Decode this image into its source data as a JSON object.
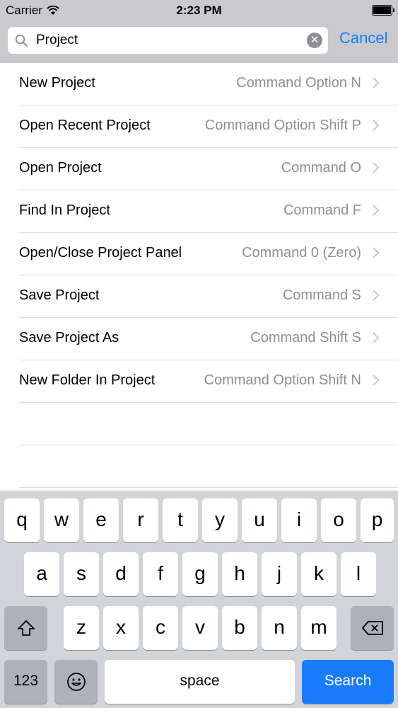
{
  "status_bar": {
    "carrier": "Carrier",
    "time": "2:23 PM"
  },
  "search": {
    "value": "Project",
    "cancel_label": "Cancel"
  },
  "commands": [
    {
      "label": "New Project",
      "shortcut": "Command Option N"
    },
    {
      "label": "Open Recent Project",
      "shortcut": "Command Option Shift P"
    },
    {
      "label": "Open Project",
      "shortcut": "Command O"
    },
    {
      "label": "Find In Project",
      "shortcut": "Command F"
    },
    {
      "label": "Open/Close Project Panel",
      "shortcut": "Command 0 (Zero)"
    },
    {
      "label": "Save Project",
      "shortcut": "Command S"
    },
    {
      "label": "Save Project As",
      "shortcut": "Command Shift S"
    },
    {
      "label": "New Folder In Project",
      "shortcut": "Command Option Shift N"
    }
  ],
  "keyboard": {
    "row1": [
      "q",
      "w",
      "e",
      "r",
      "t",
      "y",
      "u",
      "i",
      "o",
      "p"
    ],
    "row2": [
      "a",
      "s",
      "d",
      "f",
      "g",
      "h",
      "j",
      "k",
      "l"
    ],
    "row3": [
      "z",
      "x",
      "c",
      "v",
      "b",
      "n",
      "m"
    ],
    "numbers_label": "123",
    "space_label": "space",
    "search_label": "Search"
  },
  "colors": {
    "accent": "#1a7cfa",
    "secondary_text": "#8e8e93",
    "keyboard_bg": "#d1d4d9"
  }
}
